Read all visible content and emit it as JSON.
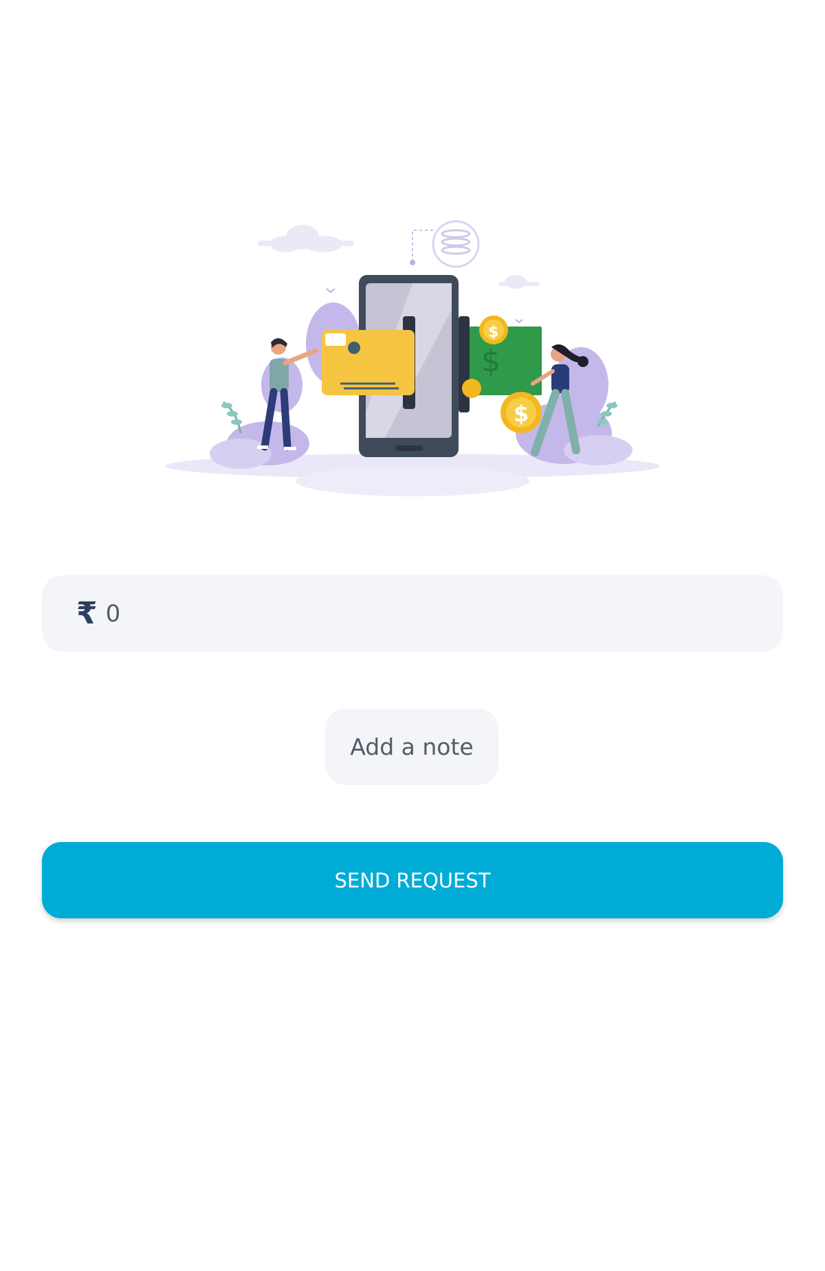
{
  "amount": {
    "currency_symbol": "₹",
    "value": "0"
  },
  "note": {
    "label": "Add a note"
  },
  "send": {
    "label": "SEND REQUEST"
  },
  "colors": {
    "accent": "#00acd6",
    "field_background": "#f4f5f9",
    "text_muted": "#555a66",
    "rupee": "#2d3e5f"
  },
  "illustration": {
    "icon": "payment-transfer-illustration"
  }
}
